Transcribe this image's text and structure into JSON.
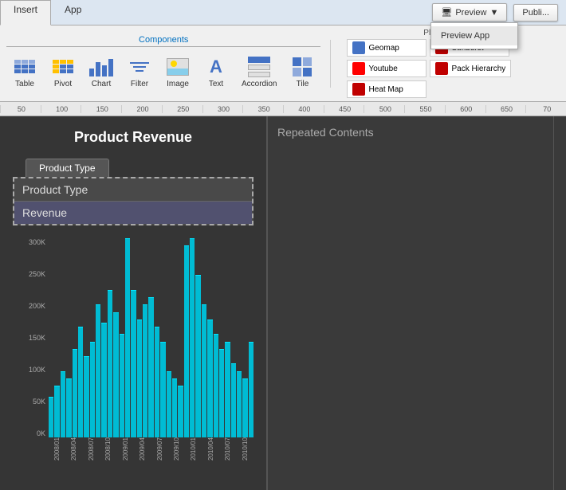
{
  "tabs": [
    {
      "label": "Insert",
      "active": true
    },
    {
      "label": "App",
      "active": false
    }
  ],
  "ribbon": {
    "components_label": "Components",
    "items": [
      {
        "name": "Table",
        "icon": "table-icon"
      },
      {
        "name": "Pivot",
        "icon": "pivot-icon"
      },
      {
        "name": "Chart",
        "icon": "chart-icon"
      },
      {
        "name": "Filter",
        "icon": "filter-icon"
      },
      {
        "name": "Image",
        "icon": "image-icon"
      },
      {
        "name": "Text",
        "icon": "text-icon"
      },
      {
        "name": "Accordion",
        "icon": "accordion-icon"
      },
      {
        "name": "Tile",
        "icon": "tile-icon"
      }
    ],
    "plugins": {
      "label": "Plug...",
      "items": [
        {
          "name": "Geomap",
          "color": "#4472c4"
        },
        {
          "name": "Sunburst",
          "color": "#c00000"
        },
        {
          "name": "Youtube",
          "color": "#ff0000"
        },
        {
          "name": "Pack Hierarchy",
          "color": "#c00000"
        },
        {
          "name": "Heat Map",
          "color": "#c00000"
        }
      ]
    },
    "preview_btn": "Preview",
    "preview_dropdown_item": "Preview App",
    "publish_btn": "Publi..."
  },
  "ruler": {
    "marks": [
      "50",
      "100",
      "150",
      "200",
      "250",
      "300",
      "350",
      "400",
      "450",
      "500",
      "550",
      "600",
      "650",
      "70"
    ]
  },
  "main": {
    "title": "Product Revenue",
    "product_type_tab": "Product Type",
    "fields": [
      {
        "label": "Product Type"
      },
      {
        "label": "Revenue"
      }
    ],
    "repeated_contents_label": "Repeated Contents",
    "chart": {
      "y_labels": [
        "300K",
        "250K",
        "200K",
        "150K",
        "100K",
        "50K",
        "0K"
      ],
      "bars": [
        55,
        70,
        90,
        80,
        120,
        150,
        110,
        130,
        180,
        155,
        200,
        170,
        140,
        270,
        200,
        160,
        180,
        190,
        150,
        130,
        90,
        80,
        70,
        260,
        270,
        220,
        180,
        160,
        140,
        120,
        130,
        100,
        90,
        80,
        130
      ],
      "x_labels": [
        "2008/01",
        "2008/04",
        "2008/07",
        "2008/10",
        "2009/01",
        "2009/04",
        "2009/07",
        "2009/10",
        "2010/01",
        "2010/04",
        "2010/07",
        "2010/10"
      ]
    }
  }
}
